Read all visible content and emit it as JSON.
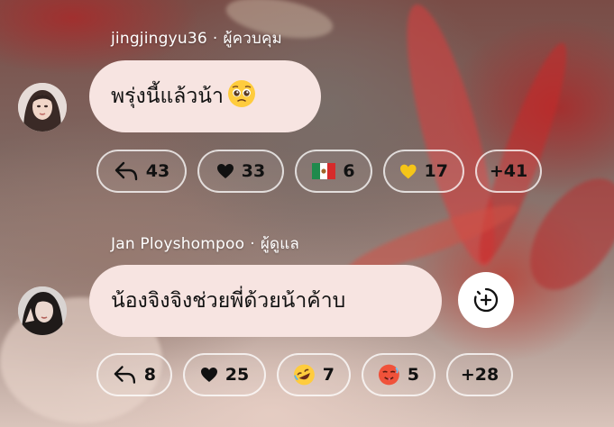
{
  "comments": [
    {
      "username": "jingjingyu36",
      "role": "ผู้ควบคุม",
      "text": "พรุ่งนี้แล้วน้า",
      "text_emoji": "pleading-face",
      "reactions": [
        {
          "icon": "reply-icon",
          "count": "43"
        },
        {
          "icon": "heart-icon",
          "count": "33"
        },
        {
          "icon": "mexico-flag-icon",
          "count": "6"
        },
        {
          "icon": "yellow-heart-icon",
          "count": "17"
        },
        {
          "icon": "",
          "count": "+41"
        }
      ]
    },
    {
      "username": "Jan Ployshompoo",
      "role": "ผู้ดูแล",
      "text": "น้องจิงจิงช่วยพี่ด้วยน้าค้าบ",
      "reactions": [
        {
          "icon": "reply-icon",
          "count": "8"
        },
        {
          "icon": "heart-icon",
          "count": "25"
        },
        {
          "icon": "rofl-emoji-icon",
          "count": "7"
        },
        {
          "icon": "hot-face-emoji-icon",
          "count": "5"
        },
        {
          "icon": "",
          "count": "+28"
        }
      ]
    }
  ],
  "separator": "·",
  "colors": {
    "bubble": "#f7e4e1",
    "chip_border": "#ffffff",
    "heart_red": "#111111",
    "yellow_heart": "#f5c518"
  }
}
